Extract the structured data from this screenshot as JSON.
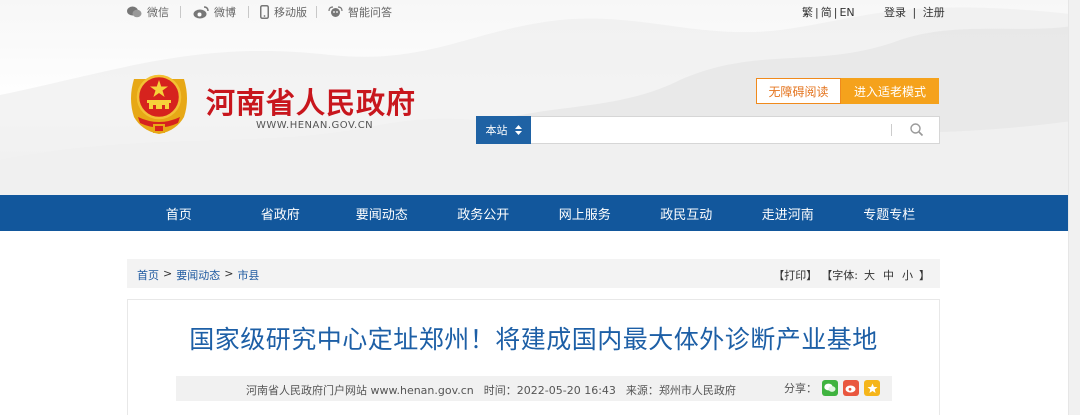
{
  "topbar": {
    "links": [
      {
        "label": "微信",
        "icon": "wechat-icon"
      },
      {
        "label": "微博",
        "icon": "weibo-icon"
      },
      {
        "label": "移动版",
        "icon": "mobile-icon"
      },
      {
        "label": "智能问答",
        "icon": "chat-bot-icon"
      }
    ],
    "lang": [
      "繁",
      "简",
      "EN"
    ],
    "login": "登录",
    "register": "注册"
  },
  "header": {
    "title": "河南省人民政府",
    "url": "WWW.HENAN.GOV.CN",
    "access_button": "无障碍阅读",
    "elder_button": "进入适老模式"
  },
  "search": {
    "scope": "本站",
    "value": "",
    "placeholder": ""
  },
  "nav": [
    "首页",
    "省政府",
    "要闻动态",
    "政务公开",
    "网上服务",
    "政民互动",
    "走进河南",
    "专题专栏"
  ],
  "breadcrumb": {
    "items": [
      "首页",
      "要闻动态",
      "市县"
    ],
    "separator": ">"
  },
  "tools": {
    "print": "【打印】",
    "font_label": "【字体:",
    "sizes": [
      "大",
      "中",
      "小"
    ],
    "font_end": "】"
  },
  "article": {
    "title": "国家级研究中心定址郑州！将建成国内最大体外诊断产业基地",
    "source_site": "河南省人民政府门户网站 www.henan.gov.cn",
    "time": "时间：2022-05-20 16:43",
    "origin": "来源：郑州市人民政府",
    "share_label": "分享："
  },
  "colors": {
    "brand_red": "#c8161d",
    "nav_blue": "#12579c",
    "title_blue": "#1d5fa6",
    "orange": "#f5a21c"
  }
}
